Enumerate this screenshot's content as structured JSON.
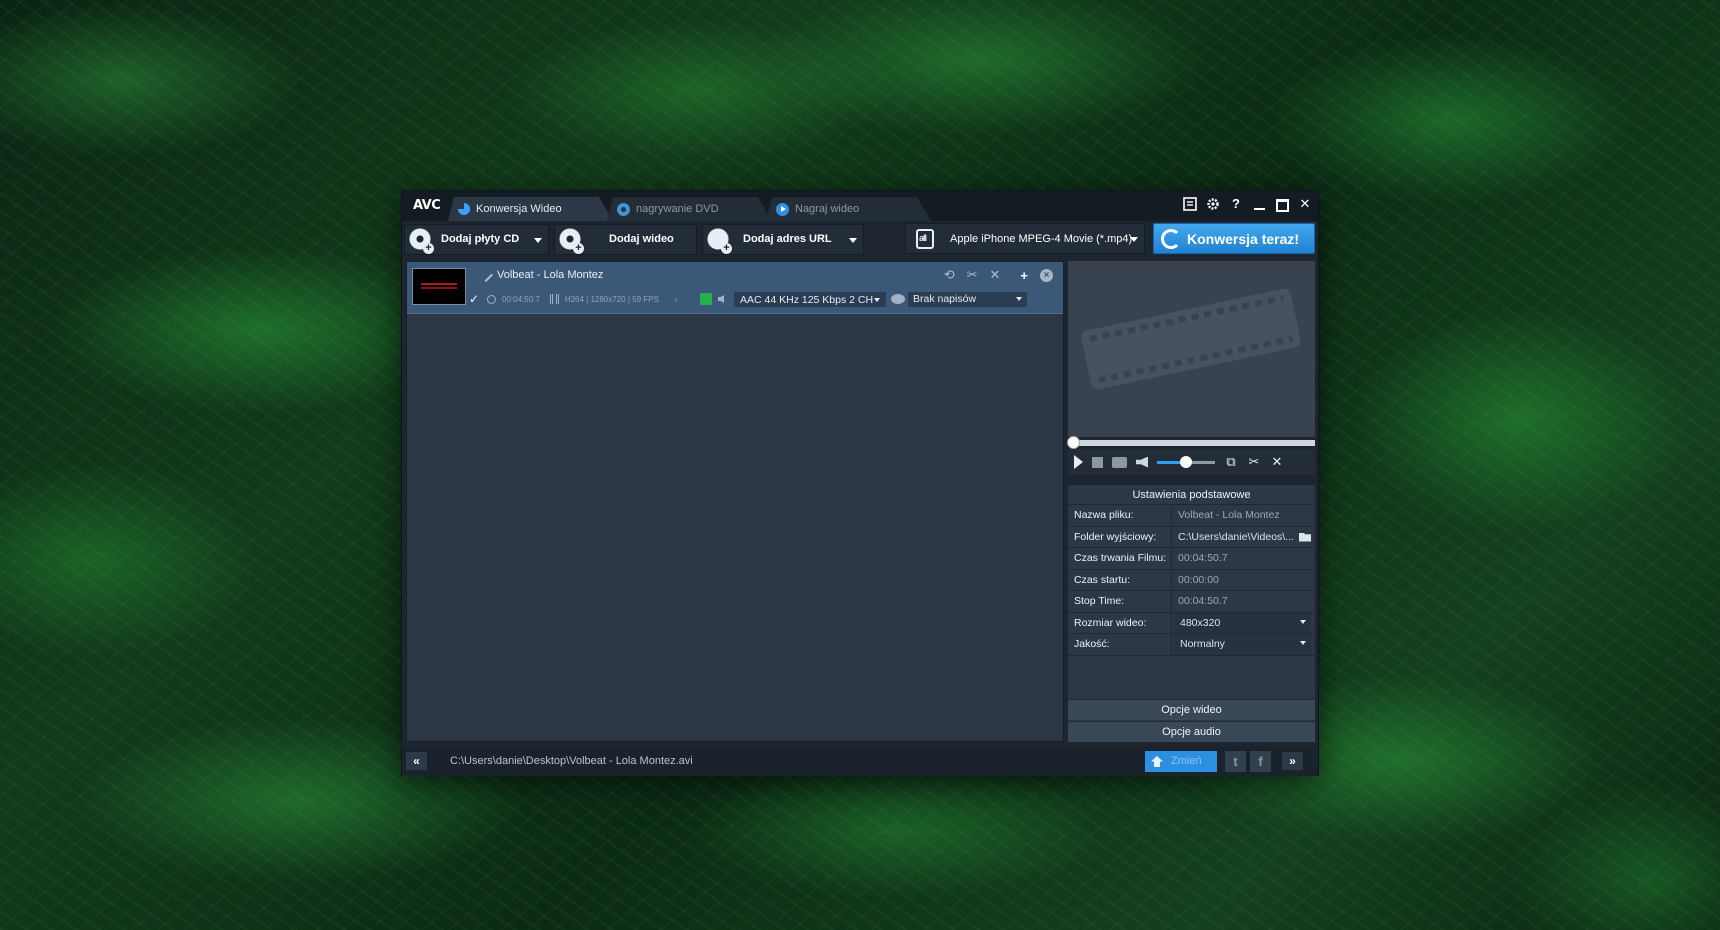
{
  "app": {
    "logo": "AVC",
    "tabs": [
      {
        "label": "Konwersja Wideo",
        "active": true
      },
      {
        "label": "nagrywanie DVD",
        "active": false
      },
      {
        "label": "Nagraj wideo",
        "active": false
      }
    ],
    "window_controls": {
      "help": "?",
      "close": "✕"
    }
  },
  "toolbar": {
    "add_cd": "Dodaj płyty CD",
    "add_video": "Dodaj wideo",
    "add_url": "Dodaj adres URL",
    "profile": "Apple iPhone MPEG-4 Movie (*.mp4)",
    "convert": "Konwersja teraz!"
  },
  "file": {
    "title": "Volbeat - Lola Montez",
    "duration": "00:04:50.7",
    "video_info": "H264 | 1280x720 | 59 FPS",
    "audio": "AAC 44 KHz 125 Kbps 2 CH",
    "subtitles": "Brak napisów",
    "checked": true
  },
  "player": {
    "volume_fraction": 0.48,
    "seek_fraction": 0.0
  },
  "settings": {
    "header": "Ustawienia podstawowe",
    "rows": [
      {
        "label": "Nazwa pliku:",
        "value": "Volbeat - Lola Montez"
      },
      {
        "label": "Folder wyjściowy:",
        "value": "C:\\Users\\danie\\Videos\\..."
      },
      {
        "label": "Czas trwania Filmu:",
        "value": "00:04:50.7"
      },
      {
        "label": "Czas startu:",
        "value": "00:00:00"
      },
      {
        "label": "Stop Time:",
        "value": "00:04:50.7"
      },
      {
        "label": "Rozmiar wideo:",
        "value": "480x320"
      },
      {
        "label": "Jakość:",
        "value": "Normalny"
      }
    ],
    "video_options": "Opcje wideo",
    "audio_options": "Opcje audio"
  },
  "statusbar": {
    "back": "«",
    "path": "C:\\Users\\danie\\Desktop\\Volbeat - Lola Montez.avi",
    "upgrade": "Zmień",
    "twitter": "t",
    "facebook": "f",
    "forward": "»"
  },
  "colors": {
    "accent": "#2d8fe2",
    "selected_row": "#3c5878",
    "window_bg": "#1c2530"
  }
}
